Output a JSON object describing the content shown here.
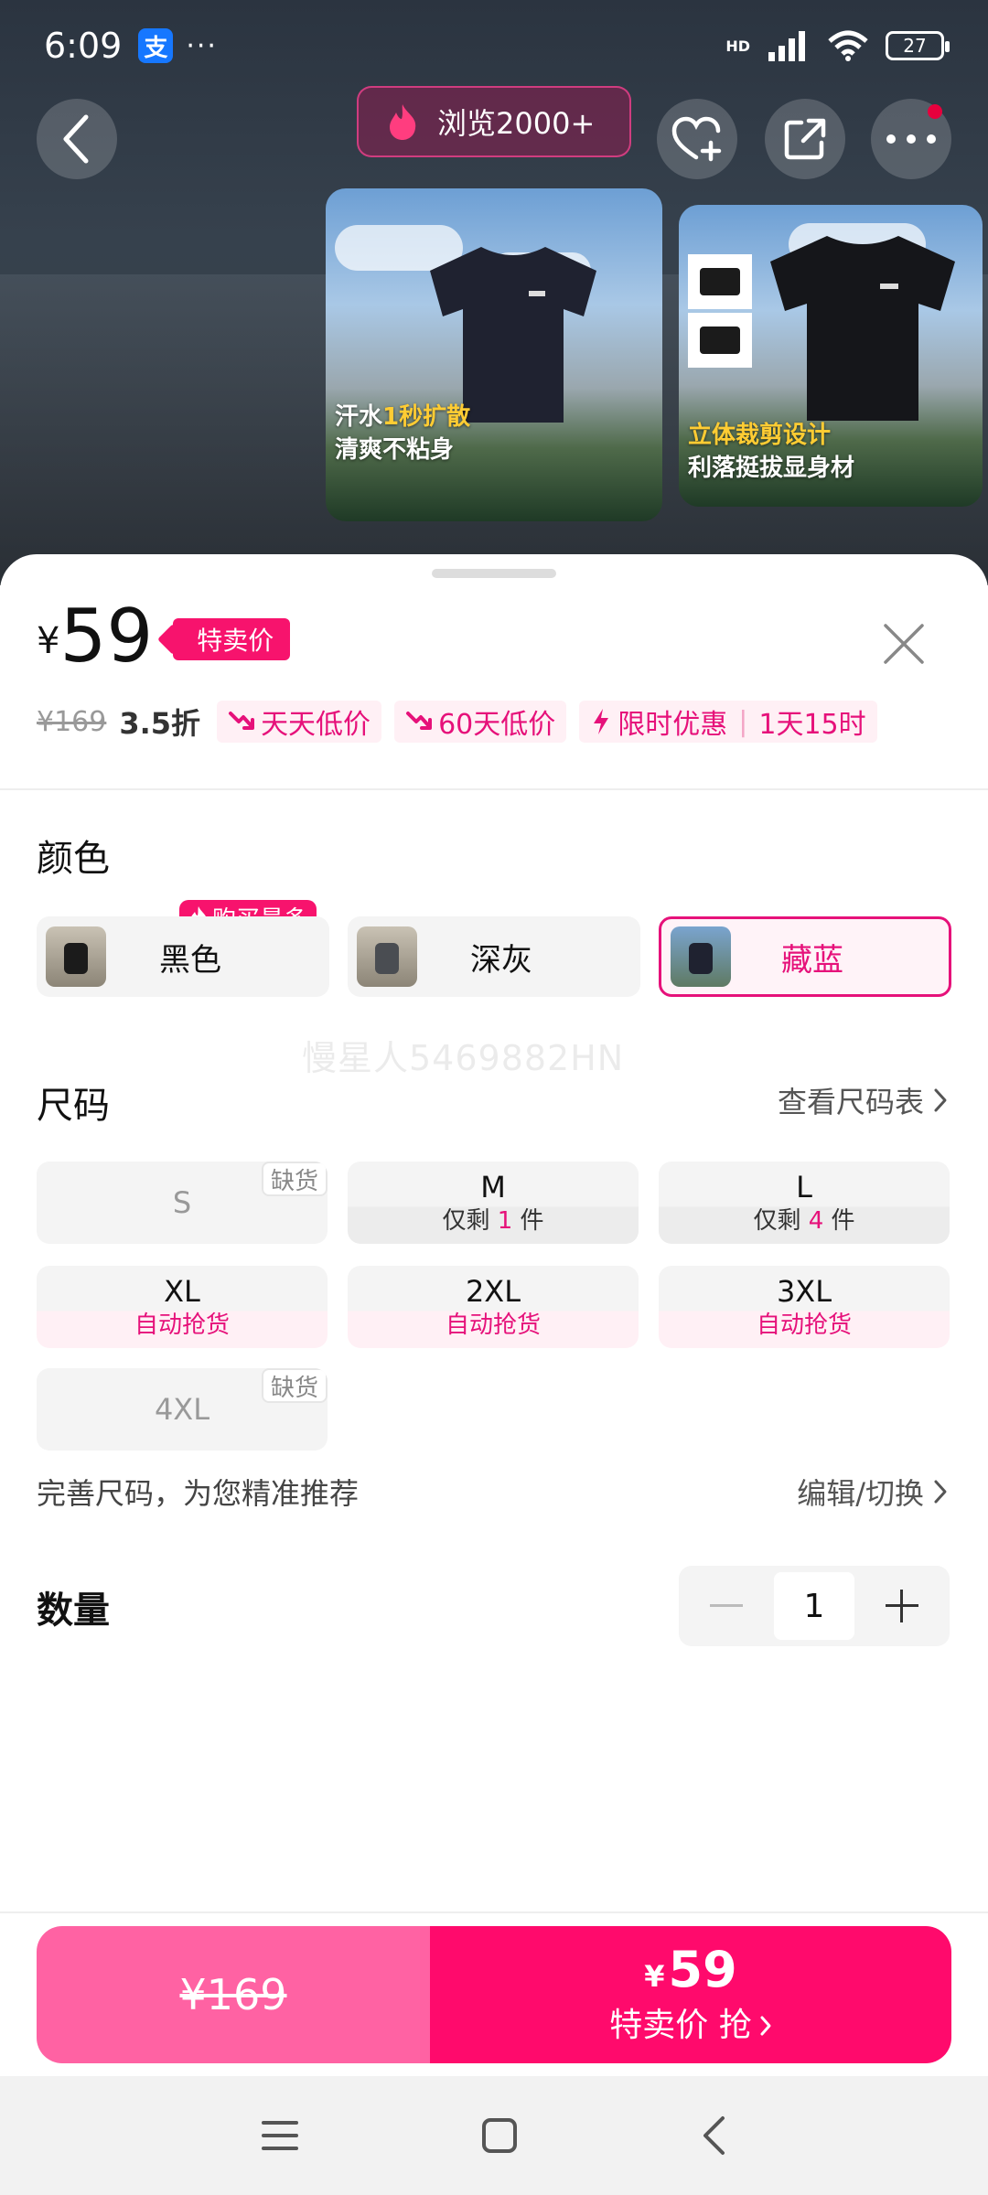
{
  "status_bar": {
    "time": "6:09",
    "alipay_glyph": "支",
    "dots": "···",
    "network": "HD",
    "battery": "27"
  },
  "header": {
    "views_label": "浏览2000+"
  },
  "product_images": [
    {
      "caption_line1_prefix": "汗水",
      "caption_line1_highlight": "1秒扩散",
      "caption_line2": "清爽不粘身"
    },
    {
      "caption_line1_highlight": "立体裁剪设计",
      "caption_line2": "利落挺拔显身材"
    }
  ],
  "price": {
    "currency": "¥",
    "value": "59",
    "tag": "特卖价",
    "original": "¥169",
    "discount": "3.5折"
  },
  "promos": [
    {
      "icon": "trend-down-icon",
      "label": "天天低价"
    },
    {
      "icon": "trend-down-icon",
      "label": "60天低价"
    },
    {
      "icon": "lightning-icon",
      "label": "限时优惠",
      "countdown": "1天15时"
    }
  ],
  "color": {
    "title": "颜色",
    "best_seller_badge": "购买最多",
    "options": [
      {
        "label": "黑色",
        "selected": false
      },
      {
        "label": "深灰",
        "selected": false
      },
      {
        "label": "藏蓝",
        "selected": true
      }
    ]
  },
  "watermark": "慢星人5469882HN",
  "size": {
    "title": "尺码",
    "chart_link": "查看尺码表",
    "out_of_stock_tag": "缺货",
    "options": [
      {
        "size": "S",
        "status": "out_of_stock"
      },
      {
        "size": "M",
        "sub_prefix": "仅剩",
        "sub_num": "1",
        "sub_suffix": "件"
      },
      {
        "size": "L",
        "sub_prefix": "仅剩",
        "sub_num": "4",
        "sub_suffix": "件"
      },
      {
        "size": "XL",
        "sub": "自动抢货"
      },
      {
        "size": "2XL",
        "sub": "自动抢货"
      },
      {
        "size": "3XL",
        "sub": "自动抢货"
      },
      {
        "size": "4XL",
        "status": "out_of_stock"
      }
    ],
    "fit_hint": "完善尺码，为您精准推荐",
    "fit_edit": "编辑/切换"
  },
  "quantity": {
    "title": "数量",
    "value": "1"
  },
  "buy_bar": {
    "original_price": "¥169",
    "currency": "¥",
    "price": "59",
    "label": "特卖价 抢"
  },
  "colors": {
    "accent": "#f7136d",
    "accent_text": "#e6117a",
    "buy_left": "#ff62a3",
    "buy_right": "#ff0a6c"
  }
}
